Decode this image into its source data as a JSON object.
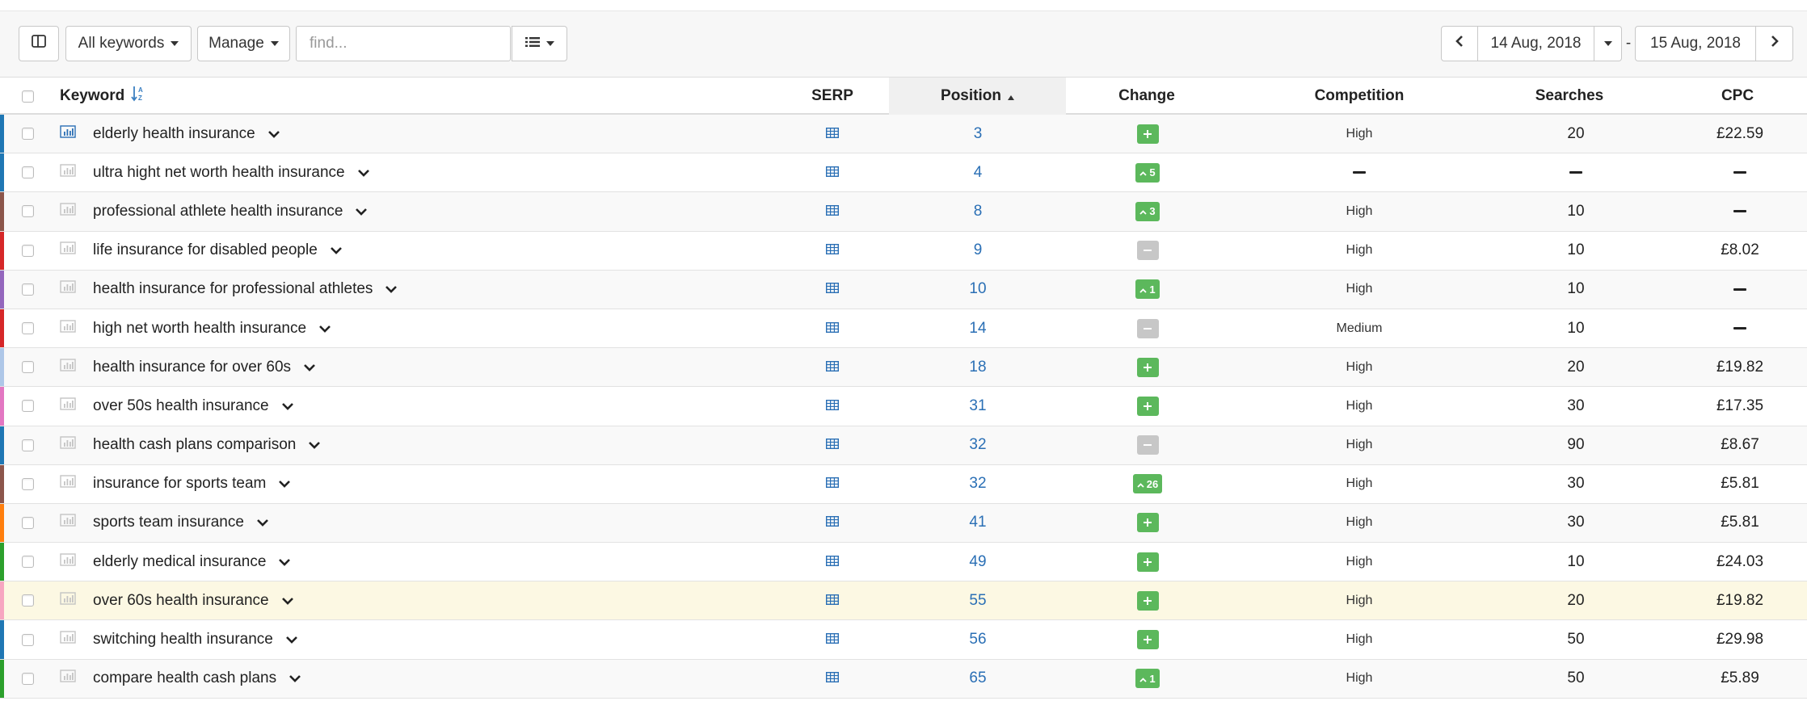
{
  "toolbar": {
    "all_keywords_label": "All keywords",
    "manage_label": "Manage",
    "find_placeholder": "find...",
    "date_from": "14 Aug, 2018",
    "date_separator": "-",
    "date_to": "15 Aug, 2018"
  },
  "columns": {
    "keyword": "Keyword",
    "serp": "SERP",
    "position": "Position",
    "change": "Change",
    "competition": "Competition",
    "searches": "Searches",
    "cpc": "CPC"
  },
  "colors": {
    "accent_link": "#2a6fb5",
    "badge_green": "#5cb85c",
    "badge_grey": "#c7c7c7",
    "highlight_row": "#fcf8e3"
  },
  "rows": [
    {
      "keyword": "elderly health insurance",
      "position": "3",
      "change_type": "new",
      "change": "",
      "competition": "High",
      "searches": "20",
      "cpc": "£22.59",
      "strip": "#1f77b4",
      "chart_active": true
    },
    {
      "keyword": "ultra hight net worth health insurance",
      "position": "4",
      "change_type": "up",
      "change": "5",
      "competition": "",
      "searches": "",
      "cpc": "",
      "strip": "#1f77b4",
      "chart_active": false
    },
    {
      "keyword": "professional athlete health insurance",
      "position": "8",
      "change_type": "up",
      "change": "3",
      "competition": "High",
      "searches": "10",
      "cpc": "",
      "strip": "#8c564b",
      "chart_active": false
    },
    {
      "keyword": "life insurance for disabled people",
      "position": "9",
      "change_type": "none",
      "change": "",
      "competition": "High",
      "searches": "10",
      "cpc": "£8.02",
      "strip": "#d62728",
      "chart_active": false
    },
    {
      "keyword": "health insurance for professional athletes",
      "position": "10",
      "change_type": "up",
      "change": "1",
      "competition": "High",
      "searches": "10",
      "cpc": "",
      "strip": "#9467bd",
      "chart_active": false
    },
    {
      "keyword": "high net worth health insurance",
      "position": "14",
      "change_type": "none",
      "change": "",
      "competition": "Medium",
      "searches": "10",
      "cpc": "",
      "strip": "#d62728",
      "chart_active": false
    },
    {
      "keyword": "health insurance for over 60s",
      "position": "18",
      "change_type": "new",
      "change": "",
      "competition": "High",
      "searches": "20",
      "cpc": "£19.82",
      "strip": "#aec7e8",
      "chart_active": false
    },
    {
      "keyword": "over 50s health insurance",
      "position": "31",
      "change_type": "new",
      "change": "",
      "competition": "High",
      "searches": "30",
      "cpc": "£17.35",
      "strip": "#e377c2",
      "chart_active": false
    },
    {
      "keyword": "health cash plans comparison",
      "position": "32",
      "change_type": "none",
      "change": "",
      "competition": "High",
      "searches": "90",
      "cpc": "£8.67",
      "strip": "#1f77b4",
      "chart_active": false
    },
    {
      "keyword": "insurance for sports team",
      "position": "32",
      "change_type": "up",
      "change": "26",
      "competition": "High",
      "searches": "30",
      "cpc": "£5.81",
      "strip": "#8c564b",
      "chart_active": false
    },
    {
      "keyword": "sports team insurance",
      "position": "41",
      "change_type": "new",
      "change": "",
      "competition": "High",
      "searches": "30",
      "cpc": "£5.81",
      "strip": "#ff7f0e",
      "chart_active": false
    },
    {
      "keyword": "elderly medical insurance",
      "position": "49",
      "change_type": "new",
      "change": "",
      "competition": "High",
      "searches": "10",
      "cpc": "£24.03",
      "strip": "#2ca02c",
      "chart_active": false
    },
    {
      "keyword": "over 60s health insurance",
      "position": "55",
      "change_type": "new",
      "change": "",
      "competition": "High",
      "searches": "20",
      "cpc": "£19.82",
      "strip": "#f7a6c1",
      "chart_active": false
    },
    {
      "keyword": "switching health insurance",
      "position": "56",
      "change_type": "new",
      "change": "",
      "competition": "High",
      "searches": "50",
      "cpc": "£29.98",
      "strip": "#1f77b4",
      "chart_active": false
    },
    {
      "keyword": "compare health cash plans",
      "position": "65",
      "change_type": "up",
      "change": "1",
      "competition": "High",
      "searches": "50",
      "cpc": "£5.89",
      "strip": "#2ca02c",
      "chart_active": false
    }
  ]
}
